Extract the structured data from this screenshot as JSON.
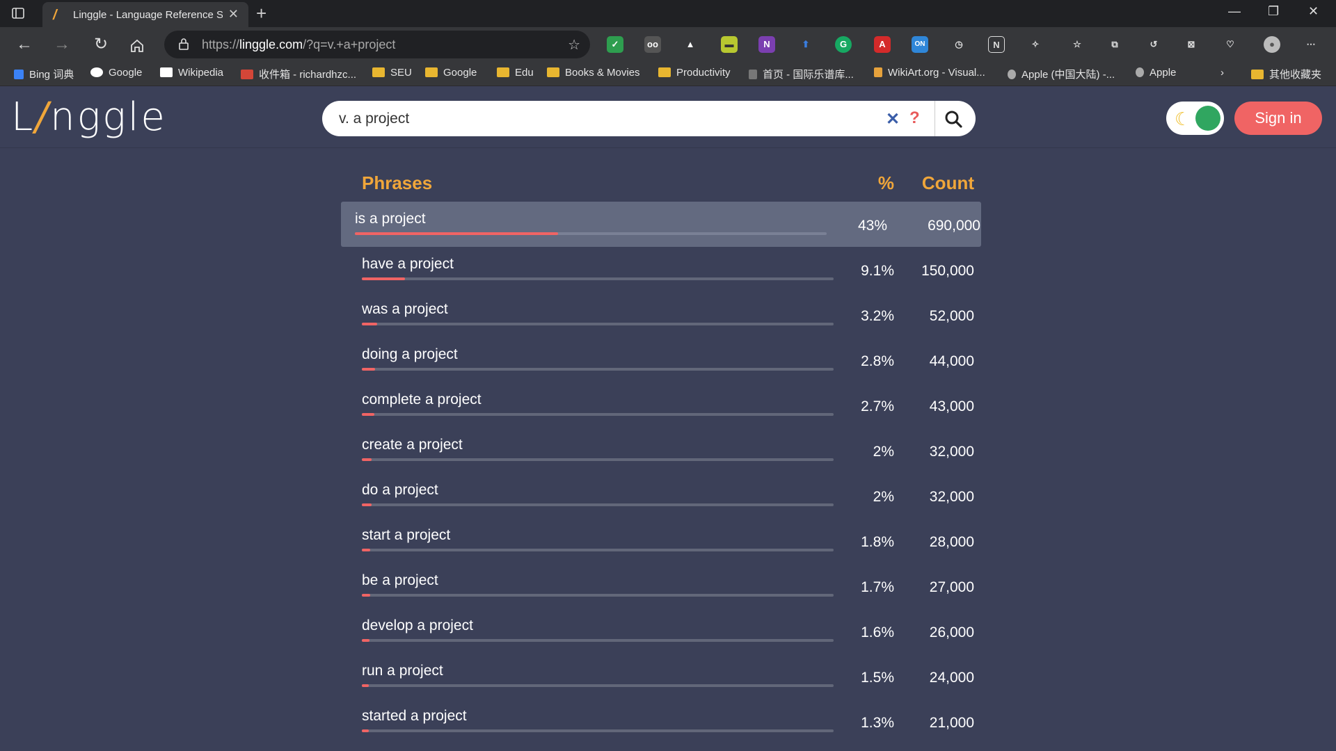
{
  "browser": {
    "tab_title": "Linggle - Language Reference Se",
    "url_prefix": "https://",
    "url_host": "linggle.com",
    "url_path": "/?q=v.+a+project",
    "bookmarks": [
      {
        "label": "Bing 词典",
        "icon": "bing-icon"
      },
      {
        "label": "Google",
        "icon": "google-icon"
      },
      {
        "label": "Wikipedia",
        "icon": "wikipedia-icon"
      },
      {
        "label": "收件箱 - richardhzc...",
        "icon": "gmail-icon"
      },
      {
        "label": "SEU",
        "icon": "folder-icon"
      },
      {
        "label": "Google",
        "icon": "folder-icon"
      },
      {
        "label": "Edu",
        "icon": "folder-icon"
      },
      {
        "label": "Books & Movies",
        "icon": "folder-icon"
      },
      {
        "label": "Productivity",
        "icon": "folder-icon"
      },
      {
        "label": "首页 - 国际乐谱库...",
        "icon": "imslp-icon"
      },
      {
        "label": "WikiArt.org - Visual...",
        "icon": "wikiart-icon"
      },
      {
        "label": "Apple (中国大陆) -...",
        "icon": "apple-icon"
      },
      {
        "label": "Apple",
        "icon": "apple-icon"
      },
      {
        "label": "其他收藏夹",
        "icon": "folder-icon"
      }
    ]
  },
  "app": {
    "logo": "Linggle",
    "search_value": "v. a project",
    "signin_label": "Sign in",
    "accent": "#f06464",
    "header_color": "#f0a63a"
  },
  "table": {
    "headers": {
      "phrase": "Phrases",
      "pct": "%",
      "count": "Count"
    },
    "rows": [
      {
        "phrase": "is a project",
        "pct": "43%",
        "count": "690,000",
        "fraction": 0.43
      },
      {
        "phrase": "have a project",
        "pct": "9.1%",
        "count": "150,000",
        "fraction": 0.091
      },
      {
        "phrase": "was a project",
        "pct": "3.2%",
        "count": "52,000",
        "fraction": 0.032
      },
      {
        "phrase": "doing a project",
        "pct": "2.8%",
        "count": "44,000",
        "fraction": 0.028
      },
      {
        "phrase": "complete a project",
        "pct": "2.7%",
        "count": "43,000",
        "fraction": 0.027
      },
      {
        "phrase": "create a project",
        "pct": "2%",
        "count": "32,000",
        "fraction": 0.02
      },
      {
        "phrase": "do a project",
        "pct": "2%",
        "count": "32,000",
        "fraction": 0.02
      },
      {
        "phrase": "start a project",
        "pct": "1.8%",
        "count": "28,000",
        "fraction": 0.018
      },
      {
        "phrase": "be a project",
        "pct": "1.7%",
        "count": "27,000",
        "fraction": 0.017
      },
      {
        "phrase": "develop a project",
        "pct": "1.6%",
        "count": "26,000",
        "fraction": 0.016
      },
      {
        "phrase": "run a project",
        "pct": "1.5%",
        "count": "24,000",
        "fraction": 0.015
      },
      {
        "phrase": "started a project",
        "pct": "1.3%",
        "count": "21,000",
        "fraction": 0.013
      }
    ]
  }
}
